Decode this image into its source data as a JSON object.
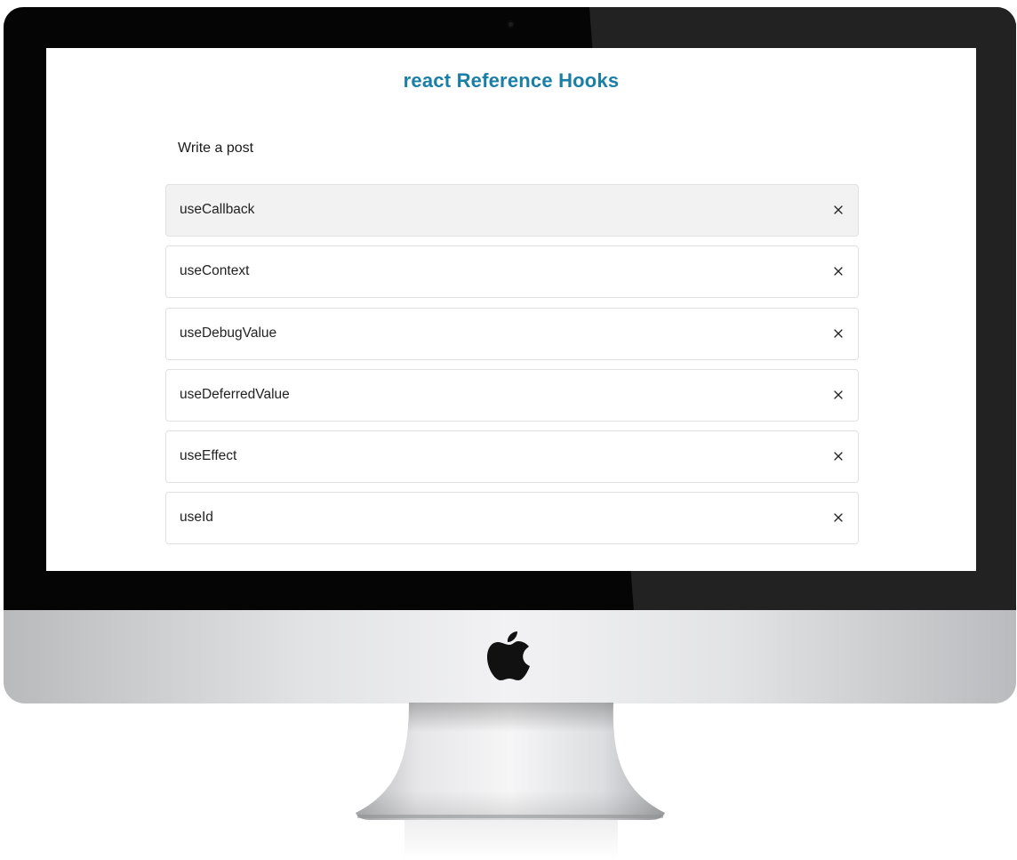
{
  "header": {
    "title": "react Reference Hooks"
  },
  "composer": {
    "link_label": "Write a post"
  },
  "hooks": {
    "items": [
      {
        "label": "useCallback",
        "highlighted": true
      },
      {
        "label": "useContext",
        "highlighted": false
      },
      {
        "label": "useDebugValue",
        "highlighted": false
      },
      {
        "label": "useDeferredValue",
        "highlighted": false
      },
      {
        "label": "useEffect",
        "highlighted": false
      },
      {
        "label": "useId",
        "highlighted": false
      }
    ],
    "remove_icon": "close-icon"
  },
  "colors": {
    "title": "#1a7fa6",
    "hover_row": "#f2f2f2",
    "row_border": "#e1e1e1"
  }
}
